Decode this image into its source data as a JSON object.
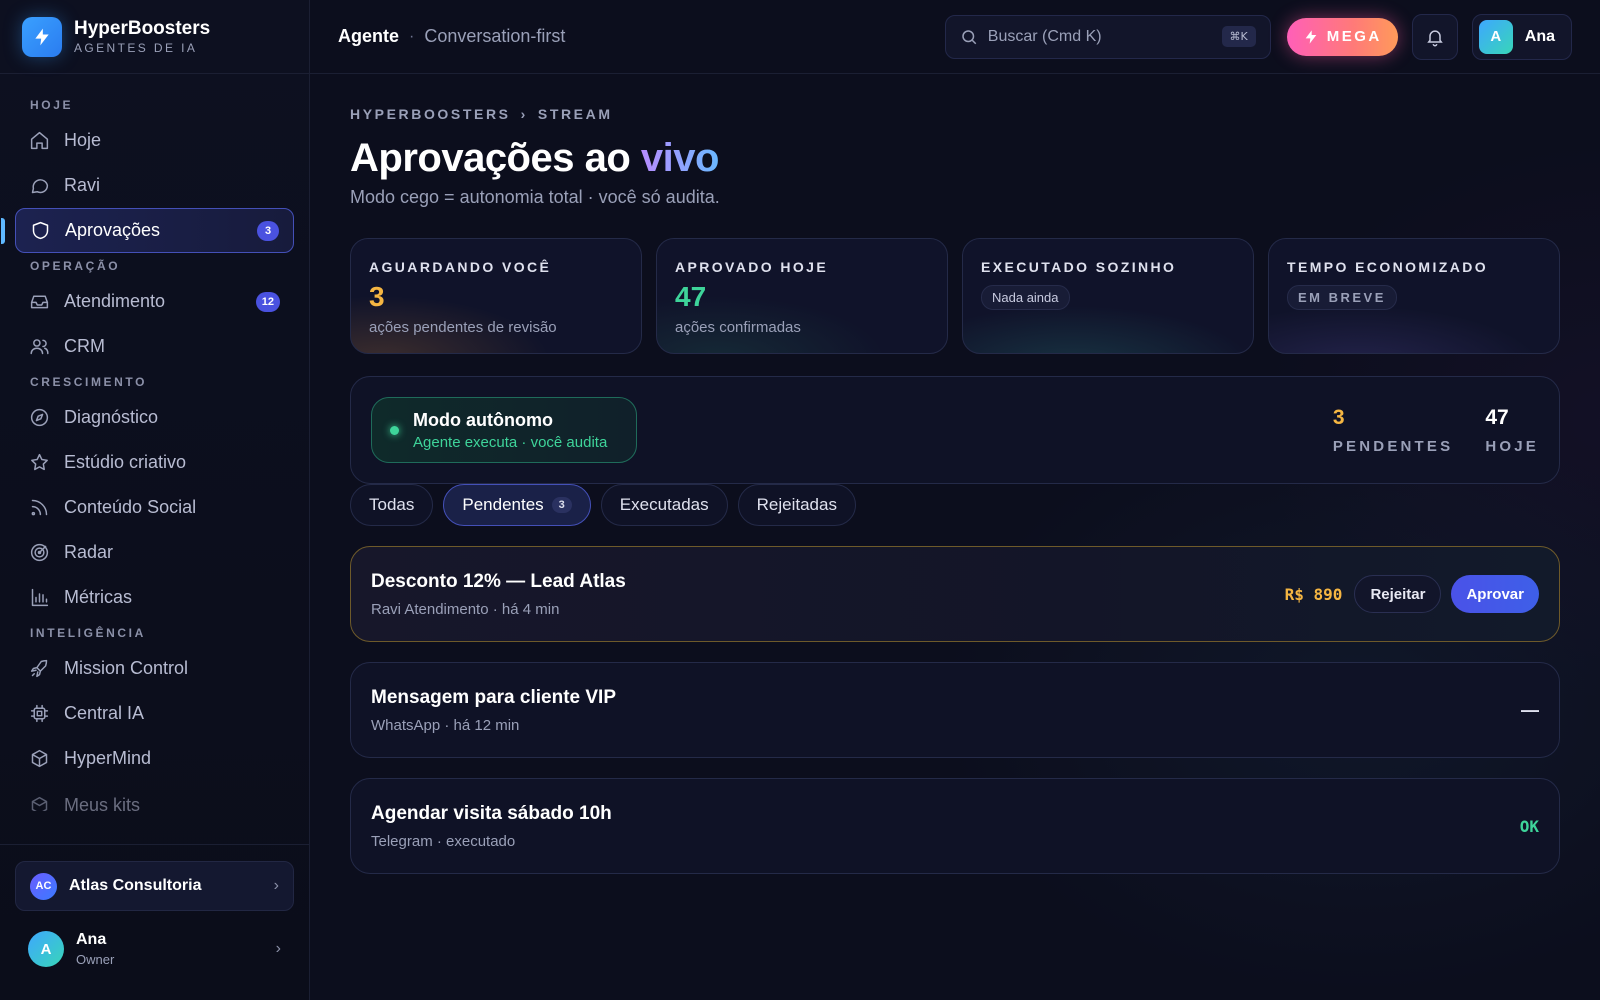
{
  "brand": {
    "name": "HyperBoosters",
    "subtitle": "AGENTES DE IA"
  },
  "sidebar": {
    "sections": {
      "hoje": "HOJE",
      "operacao": "OPERAÇÃO",
      "crescimento": "CRESCIMENTO",
      "inteligencia": "INTELIGÊNCIA"
    },
    "items": {
      "hoje": "Hoje",
      "ravi": "Ravi",
      "aprovacoes": {
        "label": "Aprovações",
        "badge": "3"
      },
      "atendimento": {
        "label": "Atendimento",
        "badge": "12"
      },
      "crm": "CRM",
      "diagnostico": "Diagnóstico",
      "estudio": "Estúdio criativo",
      "conteudo": "Conteúdo Social",
      "radar": "Radar",
      "metricas": "Métricas",
      "mission": "Mission Control",
      "central": "Central IA",
      "hypermind": "HyperMind",
      "kits": "Meus kits"
    },
    "workspace": {
      "initials": "AC",
      "name": "Atlas Consultoria"
    },
    "user": {
      "initial": "A",
      "name": "Ana",
      "role": "Owner"
    }
  },
  "topbar": {
    "title": "Agente",
    "subtitle": "Conversation-first",
    "search_placeholder": "Buscar (Cmd K)",
    "search_shortcut": "⌘K",
    "mega_label": "MEGA",
    "user_initial": "A",
    "user_name": "Ana"
  },
  "page": {
    "breadcrumb": [
      "HYPERBOOSTERS",
      "STREAM"
    ],
    "breadcrumb_sep": "›",
    "title_prefix": "Aprovações ao ",
    "title_accent": "vivo",
    "subtitle": "Modo cego = autonomia total · você só audita."
  },
  "stats": [
    {
      "label": "AGUARDANDO VOCÊ",
      "value": "3",
      "desc": "ações pendentes de revisão"
    },
    {
      "label": "APROVADO HOJE",
      "value": "47",
      "desc": "ações confirmadas"
    },
    {
      "label": "EXECUTADO SOZINHO",
      "pill": "Nada ainda"
    },
    {
      "label": "TEMPO ECONOMIZADO",
      "pill": "EM BREVE"
    }
  ],
  "autonomous": {
    "title": "Modo autônomo",
    "subtitle": "Agente executa · você audita",
    "pending_value": "3",
    "pending_label": "PENDENTES",
    "today_value": "47",
    "today_label": "HOJE"
  },
  "tabs": [
    {
      "label": "Todas"
    },
    {
      "label": "Pendentes",
      "count": "3"
    },
    {
      "label": "Executadas"
    },
    {
      "label": "Rejeitadas"
    }
  ],
  "approvals": [
    {
      "title": "Desconto 12% — Lead Atlas",
      "meta": "Ravi Atendimento · há 4 min",
      "amount": "R$ 890",
      "reject_label": "Rejeitar",
      "approve_label": "Aprovar"
    },
    {
      "title": "Mensagem para cliente VIP",
      "meta": "WhatsApp · há 12 min",
      "status": "—"
    },
    {
      "title": "Agendar visita sábado 10h",
      "meta": "Telegram · executado",
      "status": "OK"
    }
  ],
  "colors": {
    "accent": "#4a52e0",
    "amber": "#f5b642",
    "green": "#3ed49a",
    "mega_gradient": [
      "#ff5fb8",
      "#ff9a5a"
    ]
  },
  "icons": {
    "hoje": "home-icon",
    "ravi": "chat-bubble-icon",
    "aprovacoes": "shield-icon",
    "atendimento": "inbox-icon",
    "crm": "users-icon",
    "diagnostico": "compass-icon",
    "estudio": "star-icon",
    "conteudo": "rss-icon",
    "radar": "radar-icon",
    "metricas": "bar-chart-icon",
    "mission": "rocket-icon",
    "central": "cpu-icon",
    "hypermind": "cube-icon",
    "kits": "package-icon"
  }
}
